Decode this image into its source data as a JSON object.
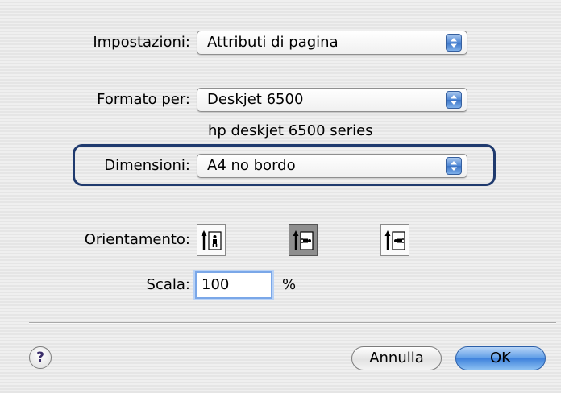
{
  "settings": {
    "label": "Impostazioni:",
    "value": "Attributi di pagina"
  },
  "format_for": {
    "label": "Formato per:",
    "value": "Deskjet 6500",
    "printer_description": "hp deskjet 6500 series"
  },
  "paper_size": {
    "label": "Dimensioni:",
    "value": "A4 no bordo"
  },
  "orientation": {
    "label": "Orientamento:",
    "options": [
      {
        "icon": "portrait-orientation-icon",
        "selected": false
      },
      {
        "icon": "landscape-left-orientation-icon",
        "selected": true
      },
      {
        "icon": "landscape-right-orientation-icon",
        "selected": false
      }
    ]
  },
  "scale": {
    "label": "Scala:",
    "value": "100",
    "unit": "%"
  },
  "buttons": {
    "help": "?",
    "cancel": "Annulla",
    "ok": "OK"
  },
  "colors": {
    "highlight_border": "#1f3a6e",
    "ok_button": "#3f82dc",
    "popup_arrows": "#4e86d4"
  }
}
